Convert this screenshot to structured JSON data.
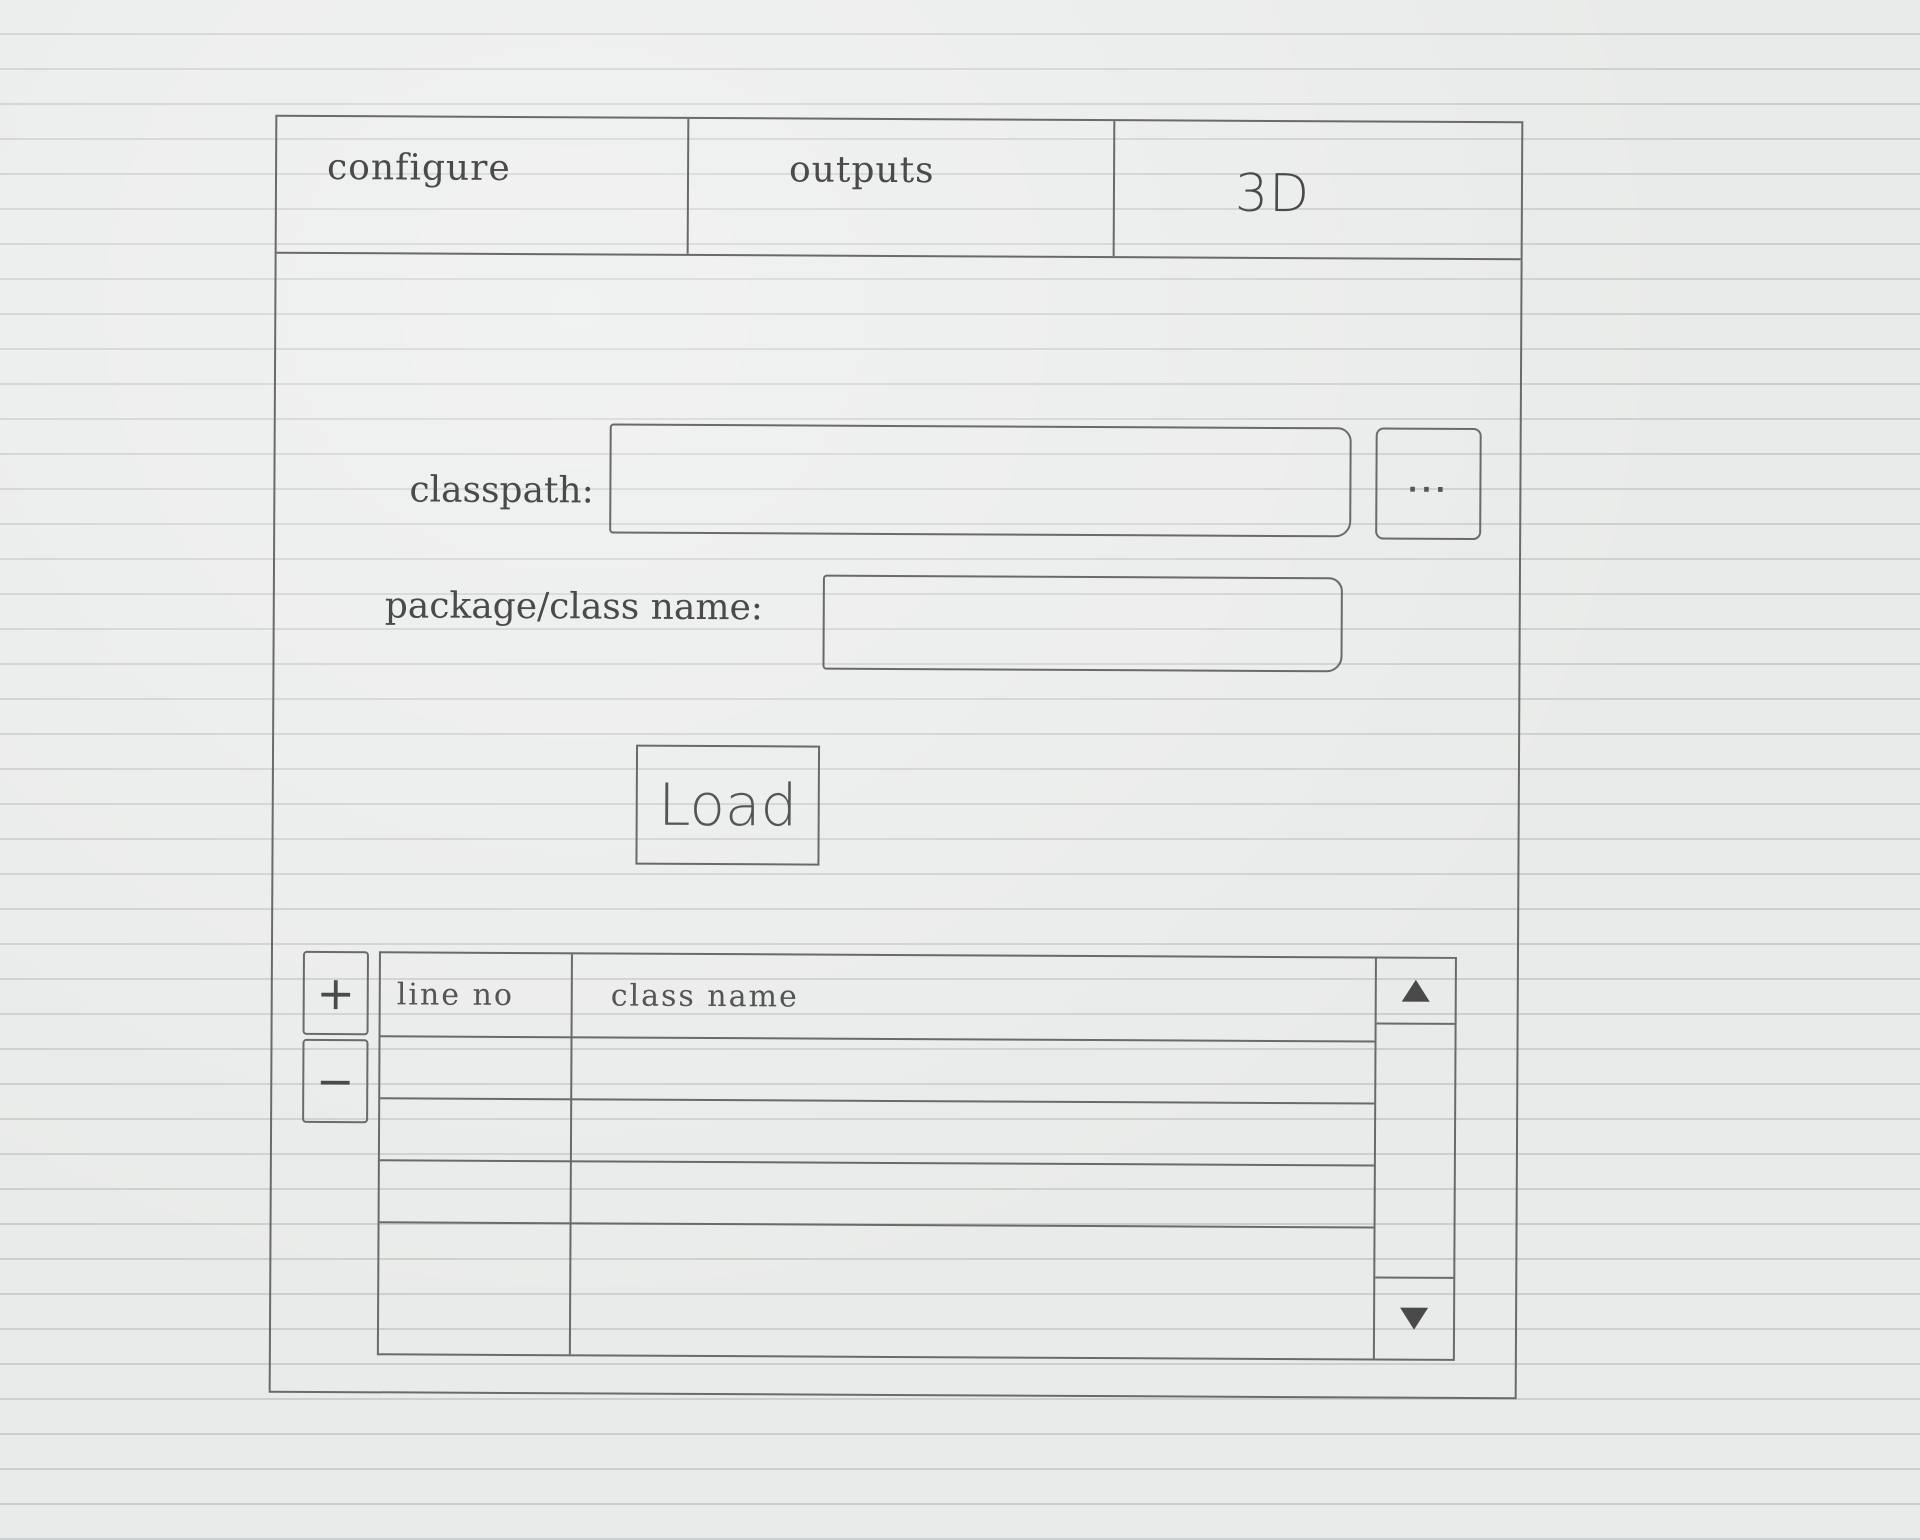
{
  "tabs": [
    {
      "label": "configure"
    },
    {
      "label": "outputs"
    },
    {
      "label": "3D"
    }
  ],
  "form": {
    "classpath_label": "classpath:",
    "classpath_value": "",
    "browse_label": "...",
    "classname_label": "package/class name:",
    "classname_value": "",
    "load_label": "Load"
  },
  "table": {
    "add_label": "+",
    "remove_label": "−",
    "columns": [
      "line no",
      "class name"
    ],
    "rows": [
      [
        "",
        ""
      ],
      [
        "",
        ""
      ],
      [
        "",
        ""
      ]
    ]
  },
  "icons": {
    "scroll_up": "triangle-up-icon",
    "scroll_down": "triangle-down-icon"
  }
}
